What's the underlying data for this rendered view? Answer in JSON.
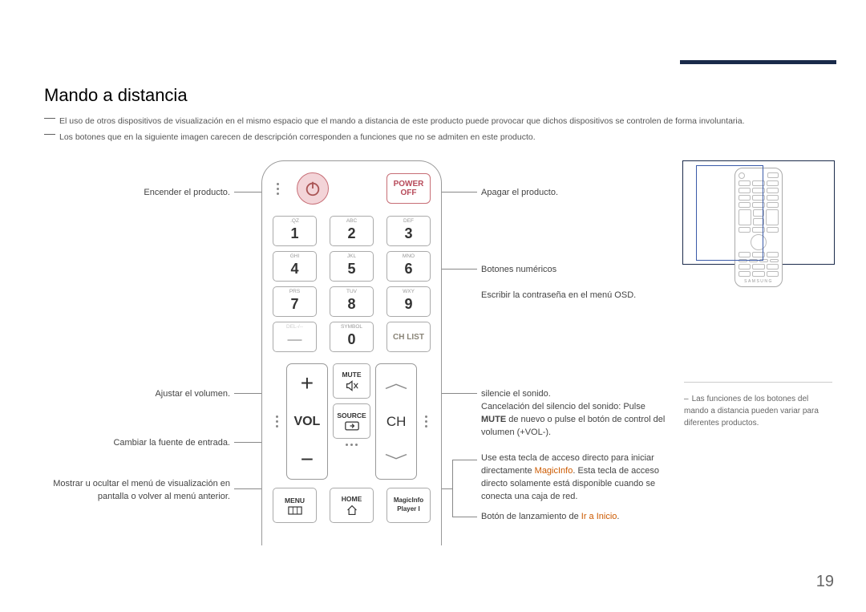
{
  "title": "Mando a distancia",
  "notes": {
    "n1": "El uso de otros dispositivos de visualización en el mismo espacio que el mando a distancia de este producto puede provocar que dichos dispositivos se controlen de forma involuntaria.",
    "n2": "Los botones que en la siguiente imagen carecen de descripción corresponden a funciones que no se admiten en este producto."
  },
  "left": {
    "l1": "Encender el producto.",
    "l2": "Ajustar el volumen.",
    "l3": "Cambiar la fuente de entrada.",
    "l4": "Mostrar u ocultar el menú de visualización en pantalla o volver al menú anterior."
  },
  "right": {
    "r1": "Apagar el producto.",
    "r2a": "Botones numéricos",
    "r2b": "Escribir la contraseña en el menú OSD.",
    "r3a": "silencie el sonido.",
    "r3b": "Cancelación del silencio del sonido: Pulse ",
    "r3b_bold": "MUTE",
    "r3b_2": " de nuevo o pulse el botón de control del volumen (+VOL-).",
    "r4a": "Use esta tecla de acceso directo para iniciar directamente ",
    "r4_orange": "MagicInfo",
    "r4b": ". Esta tecla de acceso directo solamente está disponible cuando se conecta una caja de red.",
    "r5a": "Botón de lanzamiento de ",
    "r5_orange": "Ir a Inicio",
    "r5b": "."
  },
  "remote": {
    "power_off_1": "POWER",
    "power_off_2": "OFF",
    "keys": [
      {
        "s": ".QZ",
        "n": "1"
      },
      {
        "s": "ABC",
        "n": "2"
      },
      {
        "s": "DEF",
        "n": "3"
      },
      {
        "s": "GHI",
        "n": "4"
      },
      {
        "s": "JKL",
        "n": "5"
      },
      {
        "s": "MNO",
        "n": "6"
      },
      {
        "s": "PRS",
        "n": "7"
      },
      {
        "s": "TUV",
        "n": "8"
      },
      {
        "s": "WXY",
        "n": "9"
      },
      {
        "s": "DEL-/--",
        "n": "—"
      },
      {
        "s": "SYMBOL",
        "n": "0"
      }
    ],
    "chlist": "CH LIST",
    "mute": "MUTE",
    "source": "SOURCE",
    "menu": "MENU",
    "home": "HOME",
    "magicinfo1": "MagicInfo",
    "magicinfo2": "Player I",
    "vol": "VOL",
    "ch": "CH",
    "samsung": "SAMSUNG"
  },
  "sidenote": "Las funciones de los botones del mando a distancia pueden variar para diferentes productos.",
  "page": "19"
}
